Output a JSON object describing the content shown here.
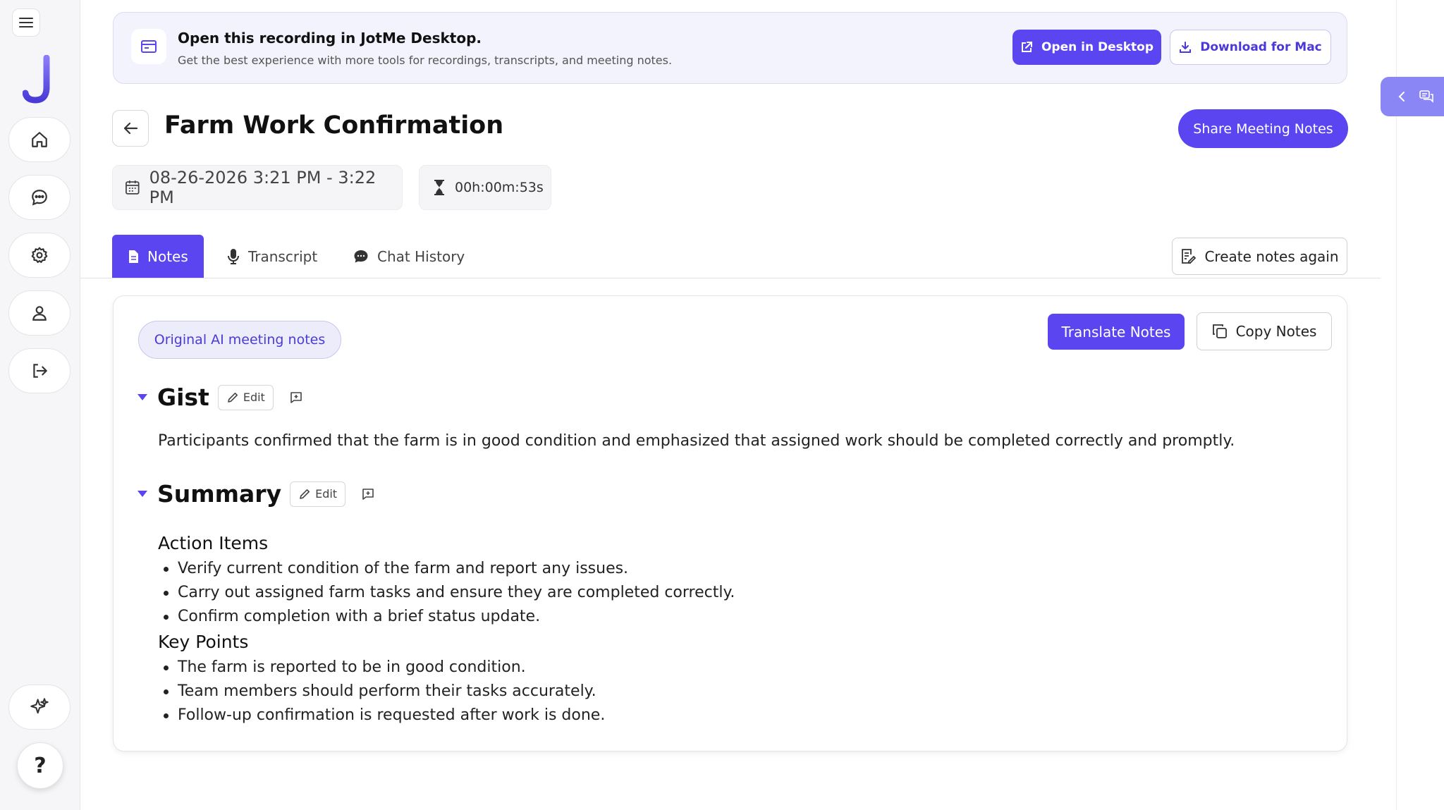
{
  "banner": {
    "title": "Open this recording in JotMe Desktop.",
    "subtitle": "Get the best experience with more tools for recordings, transcripts, and meeting notes.",
    "open_label": "Open in Desktop",
    "download_label": "Download for Mac"
  },
  "header": {
    "title": "Farm Work Confirmation",
    "share_label": "Share Meeting Notes",
    "date_range": "08-26-2026 3:21 PM - 3:22 PM",
    "duration": "00h:00m:53s"
  },
  "tabs": [
    {
      "label": "Notes",
      "active": true
    },
    {
      "label": "Transcript",
      "active": false
    },
    {
      "label": "Chat History",
      "active": false
    }
  ],
  "create_again_label": "Create notes again",
  "notes": {
    "pill_label": "Original AI meeting notes",
    "translate_label": "Translate Notes",
    "copy_label": "Copy Notes",
    "edit_label": "Edit",
    "gist": {
      "title": "Gist",
      "text": "Participants confirmed that the farm is in good condition and emphasized that assigned work should be completed correctly and promptly."
    },
    "summary": {
      "title": "Summary",
      "action_items_title": "Action Items",
      "action_items": [
        "Verify current condition of the farm and report any issues.",
        "Carry out assigned farm tasks and ensure they are completed correctly.",
        "Confirm completion with a brief status update."
      ],
      "key_points_title": "Key Points",
      "key_points": [
        "The farm is reported to be in good condition.",
        "Team members should perform their tasks accurately.",
        "Follow-up confirmation is requested after work is done."
      ]
    }
  },
  "help_label": "?",
  "colors": {
    "accent": "#5b45f0",
    "accent_light": "#ececfb",
    "logo": "#6b5cf5"
  }
}
